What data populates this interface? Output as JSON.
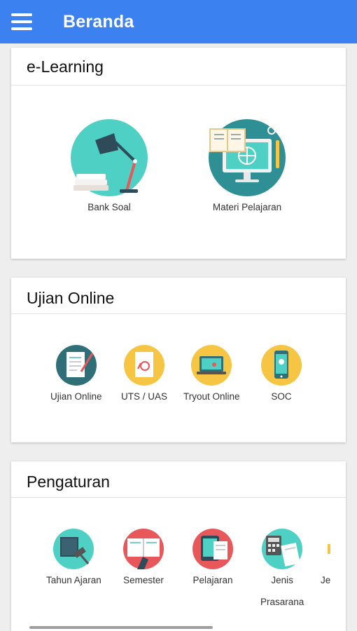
{
  "appbar": {
    "title": "Beranda",
    "menu_icon": "hamburger-menu-icon",
    "color": "#3b82f0"
  },
  "elearning": {
    "title": "e-Learning",
    "items": [
      {
        "label": "Bank Soal",
        "icon": "desk-lamp-books-icon"
      },
      {
        "label": "Materi Pelajaran",
        "icon": "monitor-book-icon"
      }
    ]
  },
  "ujian": {
    "title": "Ujian Online",
    "items": [
      {
        "label": "Ujian Online",
        "icon": "exam-paper-icon"
      },
      {
        "label": "UTS / UAS",
        "icon": "graded-paper-icon"
      },
      {
        "label": "Tryout Online",
        "icon": "laptop-icon"
      },
      {
        "label": "SOC",
        "icon": "smartphone-icon"
      }
    ]
  },
  "pengaturan": {
    "title": "Pengaturan",
    "items": [
      {
        "label": "Tahun Ajaran",
        "icon": "gavel-book-icon"
      },
      {
        "label": "Semester",
        "icon": "open-book-hand-icon"
      },
      {
        "label": "Pelajaran",
        "icon": "tablet-document-icon"
      },
      {
        "label": "Jenis",
        "label2": "Prasarana",
        "icon": "calculator-document-icon"
      },
      {
        "label": "Je",
        "icon": "partial-icon"
      }
    ]
  }
}
